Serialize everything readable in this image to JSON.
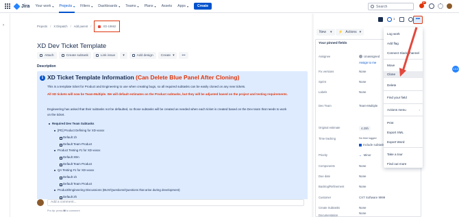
{
  "nav": {
    "product": "Jira",
    "items": [
      {
        "label": "Your work",
        "active": false
      },
      {
        "label": "Projects",
        "active": true
      },
      {
        "label": "Filters",
        "active": false
      },
      {
        "label": "Dashboards",
        "active": false
      },
      {
        "label": "Teams",
        "active": false
      },
      {
        "label": "Plans",
        "active": false
      },
      {
        "label": "Assets",
        "active": false
      },
      {
        "label": "Apps",
        "active": false
      }
    ],
    "create_label": "Create",
    "search_placeholder": "Search",
    "notification_count": "9+",
    "icons": [
      "app-switcher-icon",
      "search-icon",
      "bell-icon",
      "help-icon",
      "gear-icon",
      "avatar"
    ]
  },
  "breadcrumbs": {
    "projects": "Projects",
    "project": "X Dispatch",
    "add_parent": "Add parent",
    "ticket_id": "XD-19662"
  },
  "issue": {
    "title": "XD Dev Ticket Template",
    "toolbar": {
      "attach": "Attach",
      "create_subtask": "Create subtask",
      "link_issue": "Link issue",
      "add_design": "Add design",
      "create": "Create"
    },
    "description_label": "Description",
    "panel": {
      "heading": "XD Ticket Template Information ",
      "heading_red": "(Can Delete Blue Panel After Cloning)",
      "para1": "This is a template ticket for Product and Engineering to use when creating bugs, so all required subtasks can be easily cloned on any new tickets.",
      "para2": "All XD tickets will now be Team-Multiple.  We will default estimates on the Product subtasks, but they will be adjusted based on the project and testing requirements.",
      "para3": "Engineering has asked that their subtasks not be defaulted, so those subtasks will be created as needed when each ticket is created based on the Dev team that needs to work on the ticket.",
      "list_heading": "Required Dev Team Subtasks",
      "items": [
        {
          "label": "[PD] Product Defining for XD-xxxxx",
          "subs": [
            "Default 1h",
            "Default Team Product"
          ]
        },
        {
          "label": "Product Testing #1 for XD-xxxxx",
          "subs": [
            "Default 30m",
            "Default Team Product"
          ]
        },
        {
          "label": "QA Testing #1 for XD-xxxxx",
          "subs": [
            "Default 1h",
            "Default Team Product"
          ]
        },
        {
          "label": "Product/Engineering Discussions (BUX/Questions/Questions that arise during development)",
          "subs": [
            "Default 2h",
            "Default Team Multiple"
          ]
        }
      ]
    },
    "comment_placeholder": "Add a comment...",
    "pro_tip_prefix": "Pro tip: press ",
    "pro_tip_key": "M",
    "pro_tip_suffix": " to comment"
  },
  "side": {
    "watch_count": "1",
    "status_label": "New",
    "actions_label": "Actions",
    "pinned_title": "Your pinned fields",
    "fields": [
      {
        "label": "Assignee",
        "value": "Unassigned",
        "style": "plain"
      },
      {
        "label": "",
        "value": "Assign to me",
        "style": "link"
      },
      {
        "label": "Fix versions",
        "value": "None",
        "style": "plain"
      },
      {
        "label": "Sprint",
        "value": "None",
        "style": "plain"
      },
      {
        "label": "Labels",
        "value": "None",
        "style": "plain"
      },
      {
        "label": "Dev Team",
        "value": "Team-Multiple",
        "style": "plain"
      },
      {
        "label": "Original estimate",
        "value": "4.25h",
        "style": "tag"
      },
      {
        "label": "Time tracking",
        "value": "No time logged",
        "style": "plain"
      },
      {
        "label": "",
        "value": "Include subtasks",
        "style": "check"
      },
      {
        "label": "Priority",
        "value": "Minor",
        "style": "plain"
      },
      {
        "label": "Components",
        "value": "None",
        "style": "plain"
      },
      {
        "label": "Due date",
        "value": "None",
        "style": "plain"
      },
      {
        "label": "Backlog/Refinement",
        "value": "None",
        "style": "plain"
      },
      {
        "label": "Customer",
        "value": "CXT Software 9999",
        "style": "plain"
      },
      {
        "label": "Create Subtasks",
        "value": "None",
        "style": "plain"
      },
      {
        "label": "Documentation",
        "value": "",
        "style": "plain"
      },
      {
        "label": "",
        "value": "None",
        "style": "plain"
      }
    ]
  },
  "dropdown": {
    "items": [
      {
        "label": "Log work"
      },
      {
        "label": "Add flag"
      },
      {
        "label": "Connect Slack channel"
      },
      {
        "label": "Move"
      },
      {
        "label": "Clone",
        "active": true
      },
      {
        "label": "Delete"
      },
      {
        "label": "Find your field"
      },
      {
        "label": "Actions menu"
      },
      {
        "label": "Print"
      },
      {
        "label": "Export XML"
      },
      {
        "label": "Export Word"
      },
      {
        "label": "Take a tour"
      },
      {
        "label": "Find out more"
      }
    ]
  },
  "colors": {
    "brand": "#0052cc",
    "highlight_red": "#de350b",
    "panel_bg": "#deebff"
  }
}
